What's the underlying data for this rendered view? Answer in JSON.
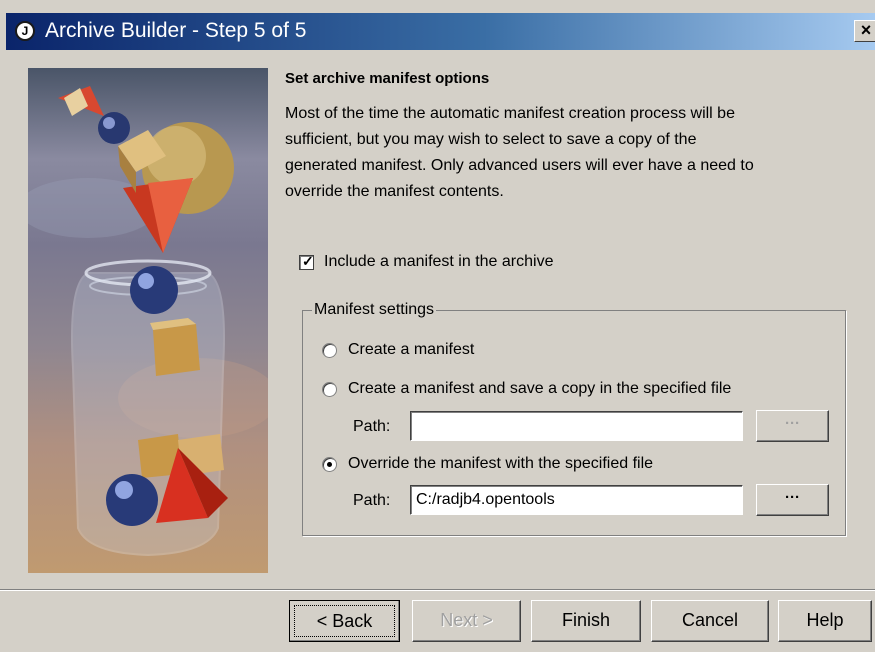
{
  "window": {
    "title": "Archive Builder - Step 5 of 5",
    "title_icon_glyph": "J",
    "close_glyph": "×"
  },
  "content": {
    "heading": "Set archive manifest options",
    "description_lines": [
      "Most of the time the automatic manifest creation process will be",
      "sufficient, but you may wish to select to save a copy of the",
      "generated manifest. Only advanced users will ever have a need to",
      "override the manifest contents."
    ],
    "include_manifest": {
      "label": "Include a manifest in the archive",
      "checked": true
    },
    "manifest_settings": {
      "group_label": "Manifest settings",
      "option_create": {
        "label": "Create a manifest",
        "selected": false
      },
      "option_create_save": {
        "label": "Create a manifest and save a copy in the specified file",
        "selected": false
      },
      "path1": {
        "label": "Path:",
        "value": ""
      },
      "option_override": {
        "label": "Override the manifest with the specified file",
        "selected": true
      },
      "path2": {
        "label": "Path:",
        "value": "C:/radjb4.opentools"
      },
      "browse_glyph": "···"
    }
  },
  "buttons": {
    "back": "< Back",
    "next": "Next >",
    "finish": "Finish",
    "cancel": "Cancel",
    "help": "Help"
  }
}
